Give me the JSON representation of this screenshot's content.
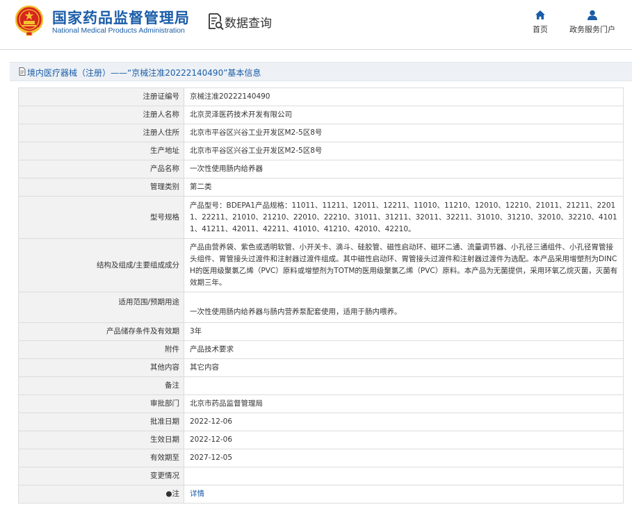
{
  "header": {
    "title_cn": "国家药品监督管理局",
    "title_en": "National Medical Products Administration",
    "query_label": "数据查询",
    "nav": {
      "home": "首页",
      "service": "政务服务门户"
    }
  },
  "page": {
    "title": "境内医疗器械（注册）——“京械注准20222140490”基本信息"
  },
  "rows": [
    {
      "label": "注册证编号",
      "value": "京械注准20222140490"
    },
    {
      "label": "注册人名称",
      "value": "北京灵泽医药技术开发有限公司"
    },
    {
      "label": "注册人住所",
      "value": "北京市平谷区兴谷工业开发区M2-5区8号"
    },
    {
      "label": "生产地址",
      "value": "北京市平谷区兴谷工业开发区M2-5区8号"
    },
    {
      "label": "产品名称",
      "value": "一次性使用肠内给养器"
    },
    {
      "label": "管理类别",
      "value": "第二类"
    },
    {
      "label": "型号规格",
      "value": "产品型号：BDEPA1产品规格：11011、11211、12011、12211、11010、11210、12010、12210、21011、21211、22011、22211、21010、21210、22010、22210、31011、31211、32011、32211、31010、31210、32010、32210、41011、41211、42011、42211、41010、41210、42010、42210。"
    },
    {
      "label": "结构及组成/主要组成成分",
      "value": "产品由营养袋、紫色或透明软管、小开关卡、滴斗、硅胶管、磁性启动环、磁环二通、流量调节器、小孔径三通组件、小孔径胃管接头组件、胃管接头过渡件和注射器过渡件组成。其中磁性启动环、胃管接头过渡件和注射器过渡件为选配。本产品采用增塑剂为DINCH的医用级聚氯乙烯（PVC）原料或增塑剂为TOTM的医用级聚氯乙烯（PVC）原料。本产品为无菌提供，采用环氧乙烷灭菌，灭菌有效期三年。"
    },
    {
      "label": "适用范围/预期用途",
      "value": "一次性使用肠内给养器与肠内营养泵配套使用，适用于肠内喂养。"
    },
    {
      "label": "产品储存条件及有效期",
      "value": "3年"
    },
    {
      "label": "附件",
      "value": "产品技术要求"
    },
    {
      "label": "其他内容",
      "value": "其它内容"
    },
    {
      "label": "备注",
      "value": ""
    },
    {
      "label": "审批部门",
      "value": "北京市药品监督管理局"
    },
    {
      "label": "批准日期",
      "value": "2022-12-06"
    },
    {
      "label": "生效日期",
      "value": "2022-12-06"
    },
    {
      "label": "有效期至",
      "value": "2027-12-05"
    },
    {
      "label": "变更情况",
      "value": ""
    },
    {
      "label": "●注",
      "value": "详情"
    }
  ],
  "colors": {
    "brand_blue": "#1a5ca8",
    "label_bg": "#f2f2f2",
    "titlebar_bg": "#edf1f5",
    "emblem_red": "#d7261e",
    "emblem_gold": "#f2c230"
  },
  "icons": {
    "logo": "national-emblem-icon",
    "query": "document-search-icon",
    "home": "home-icon",
    "service": "user-icon",
    "title": "document-icon"
  }
}
